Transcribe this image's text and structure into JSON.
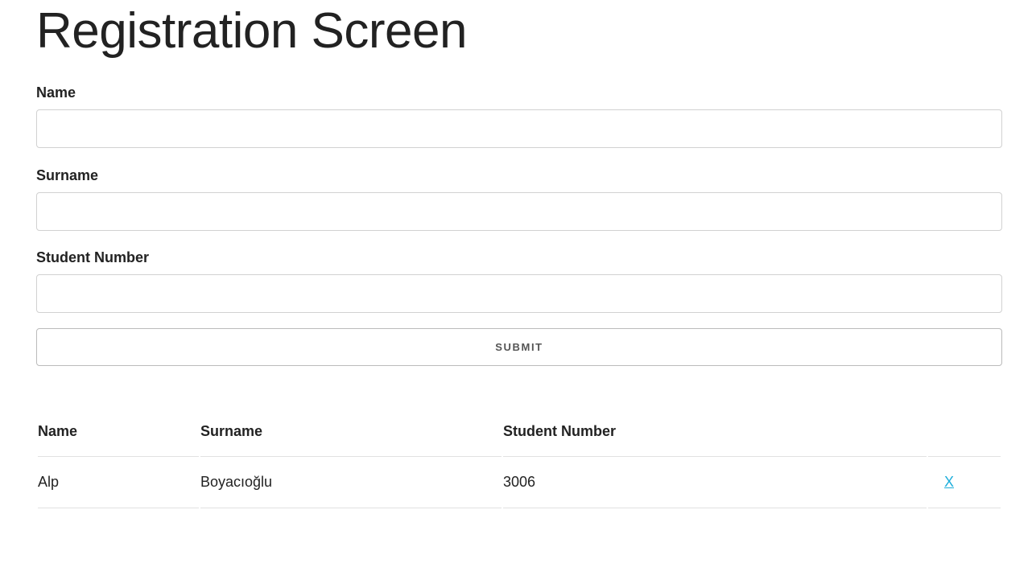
{
  "page": {
    "title": "Registration Screen"
  },
  "form": {
    "name_label": "Name",
    "name_value": "",
    "surname_label": "Surname",
    "surname_value": "",
    "number_label": "Student Number",
    "number_value": "",
    "submit_label": "SUBMIT"
  },
  "table": {
    "headers": [
      "Name",
      "Surname",
      "Student Number",
      ""
    ],
    "rows": [
      {
        "name": "Alp",
        "surname": "Boyacıoğlu",
        "student_number": "3006",
        "remove_label": "X"
      }
    ]
  },
  "colors": {
    "text": "#222222",
    "link": "#1eaedb",
    "border": "#d1d1d1"
  }
}
